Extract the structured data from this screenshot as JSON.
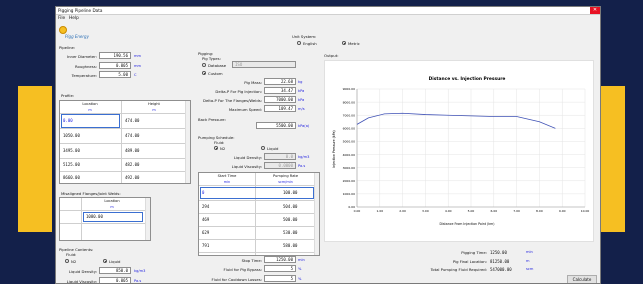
{
  "window": {
    "title": "Pigging Pipeline Data",
    "close_glyph": "✕"
  },
  "menu": {
    "file": "File",
    "help": "Help"
  },
  "logo": {
    "text": "Pigg Energy"
  },
  "pipeline": {
    "group_label": "Pipeline:",
    "inner_diameter": {
      "label": "Inner Diameter:",
      "value": "190.56",
      "unit": "mm"
    },
    "roughness": {
      "label": "Roughness:",
      "value": "0.005",
      "unit": "mm"
    },
    "temperature": {
      "label": "Temperature:",
      "value": "5.00",
      "unit": "C"
    }
  },
  "profile": {
    "label": "Profile:",
    "col_location": "Location",
    "col_location_unit": "m",
    "col_height": "Height",
    "col_height_unit": "m",
    "rows": [
      {
        "location": "0.00",
        "height": "474.00"
      },
      {
        "location": "1050.00",
        "height": "474.00"
      },
      {
        "location": "3495.00",
        "height": "489.00"
      },
      {
        "location": "5125.00",
        "height": "482.00"
      },
      {
        "location": "8660.00",
        "height": "492.00"
      }
    ]
  },
  "flanges": {
    "label": "Misaligned Flanges/Joint Welds:",
    "col": "Location",
    "unit": "m",
    "rows": [
      "1080.00"
    ]
  },
  "contents": {
    "label": "Pipeline Contents:",
    "fluid_label": "Fluid:",
    "n2": "N2",
    "liquid": "Liquid",
    "density": {
      "label": "Liquid Density:",
      "value": "850.0",
      "unit": "kg/m3"
    },
    "viscosity": {
      "label": "Liquid Viscosity:",
      "value": "0.005",
      "unit": "Pa.s"
    }
  },
  "pigging": {
    "label": "Pigging:",
    "pig_types": "Pig Types:",
    "database": "Database",
    "database_value": "ISO",
    "custom": "Custom",
    "pig_mass": {
      "label": "Pig Mass:",
      "value": "22.68",
      "unit": "kg"
    },
    "delta_p": {
      "label": "Delta-P For Pig Injection:",
      "value": "34.47",
      "unit": "kPa"
    },
    "delta_p_flange": {
      "label": "Delta-P For The Flanges/Welds:",
      "value": "7000.00",
      "unit": "kPa"
    },
    "max_speed": {
      "label": "Maximum Speed:",
      "value": "109.47",
      "unit": "m/s"
    }
  },
  "back_pressure": {
    "label": "Back Pressure:",
    "value": "5500.00",
    "unit": "kPa(a)"
  },
  "schedule": {
    "label": "Pumping Schedule:",
    "fluid_label": "Fluid:",
    "n2": "N2",
    "liquid": "Liquid",
    "density": {
      "label": "Liquid Density:",
      "value": "0.0",
      "unit": "kg/m3"
    },
    "viscosity": {
      "label": "Liquid Viscosity:",
      "value": "0.0000",
      "unit": "Pa.s"
    },
    "col_start": "Start Time",
    "col_start_unit": "min",
    "col_rate": "Pumping Rate",
    "col_rate_unit": "scm/min",
    "rows": [
      {
        "start": "0",
        "rate": "100.00"
      },
      {
        "start": "294",
        "rate": "504.00"
      },
      {
        "start": "469",
        "rate": "500.00"
      },
      {
        "start": "629",
        "rate": "530.00"
      },
      {
        "start": "791",
        "rate": "580.00"
      }
    ]
  },
  "stop": {
    "stop_time": {
      "label": "Stop Time:",
      "value": "1250.00",
      "unit": "min"
    },
    "fluid_bypass": {
      "label": "Fluid for Pig Bypass:",
      "value": "5",
      "unit": "%"
    },
    "fluid_cooldown": {
      "label": "Fluid for Cooldown Losses:",
      "value": "5",
      "unit": "%"
    }
  },
  "unit_system": {
    "label": "Unit System:",
    "english": "English",
    "metric": "Metric"
  },
  "output": {
    "label": "Output:"
  },
  "chart_data": {
    "type": "line",
    "title": "Distance vs. Injection Pressure",
    "xlabel": "Distance From Injection Point (km)",
    "ylabel": "Injection Pressure (kPa)",
    "xlim": [
      0,
      10
    ],
    "ylim": [
      0,
      9000
    ],
    "x_ticks": [
      "0.00",
      "1.00",
      "2.00",
      "3.00",
      "4.00",
      "5.00",
      "6.00",
      "7.00",
      "8.00",
      "9.00",
      "10.00"
    ],
    "y_ticks": [
      "0.00",
      "1000.00",
      "2000.00",
      "3000.00",
      "4000.00",
      "5000.00",
      "6000.00",
      "7000.00",
      "8000.00",
      "9000.00"
    ],
    "series": [
      {
        "color": "#3f51b5",
        "x": [
          0,
          0.5,
          1.2,
          2,
          3,
          4,
          5,
          6,
          7,
          8,
          8.7
        ],
        "y": [
          6300,
          6800,
          7100,
          7150,
          7050,
          7000,
          6950,
          6900,
          6900,
          6500,
          6000
        ]
      }
    ]
  },
  "results": {
    "pig_time": {
      "label": "Pigging Time:",
      "value": "1250.00",
      "unit": "min"
    },
    "final_location": {
      "label": "Pig Final Location:",
      "value": "81250.00",
      "unit": "m"
    },
    "total_fluid": {
      "label": "Total Pumping Fluid Required:",
      "value": "547000.00",
      "unit": "scm"
    }
  },
  "calculate": "Calculate"
}
